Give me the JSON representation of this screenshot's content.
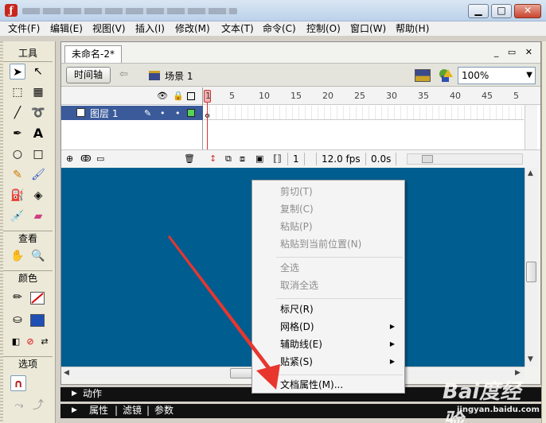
{
  "window": {
    "title_obscured": true
  },
  "menubar": [
    "文件(F)",
    "编辑(E)",
    "视图(V)",
    "插入(I)",
    "修改(M)",
    "文本(T)",
    "命令(C)",
    "控制(O)",
    "窗口(W)",
    "帮助(H)"
  ],
  "tools": {
    "header": "工具",
    "view_header": "查看",
    "colors_header": "颜色",
    "options_header": "选项",
    "fill_color": "#1d4fb5",
    "stroke_color": "#ffffff"
  },
  "document": {
    "tab_title": "未命名-2*",
    "timeline_button": "时间轴",
    "scene": "场景 1",
    "zoom": "100%"
  },
  "timeline": {
    "frame_numbers": [
      "1",
      "5",
      "10",
      "15",
      "20",
      "25",
      "30",
      "35",
      "40",
      "45",
      "5"
    ],
    "layer_name": "图层 1",
    "current_frame": "1",
    "fps": "12.0 fps",
    "time": "0.0s"
  },
  "stage": {
    "background": "#005d8f"
  },
  "panels": {
    "actions": "动作",
    "properties": "属性",
    "filters": "滤镜",
    "parameters": "参数"
  },
  "context_menu": {
    "groups": [
      [
        {
          "label": "剪切(T)",
          "enabled": false
        },
        {
          "label": "复制(C)",
          "enabled": false
        },
        {
          "label": "粘贴(P)",
          "enabled": false
        },
        {
          "label": "粘贴到当前位置(N)",
          "enabled": false
        }
      ],
      [
        {
          "label": "全选",
          "enabled": false
        },
        {
          "label": "取消全选",
          "enabled": false
        }
      ],
      [
        {
          "label": "标尺(R)",
          "enabled": true
        },
        {
          "label": "网格(D)",
          "enabled": true,
          "submenu": true
        },
        {
          "label": "辅助线(E)",
          "enabled": true,
          "submenu": true
        },
        {
          "label": "贴紧(S)",
          "enabled": true,
          "submenu": true
        }
      ],
      [
        {
          "label": "文档属性(M)...",
          "enabled": true
        }
      ]
    ]
  },
  "watermark": {
    "main": "Bai度经验",
    "url": "jingyan.baidu.com"
  }
}
